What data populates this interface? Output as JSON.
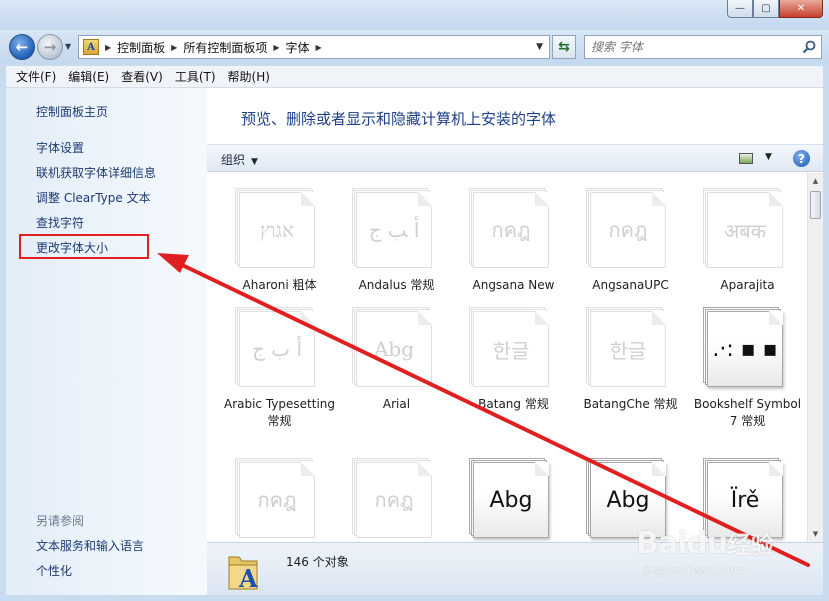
{
  "address": {
    "breadcrumbs": [
      "控制面板",
      "所有控制面板项",
      "字体"
    ]
  },
  "search": {
    "placeholder": "搜索 字体"
  },
  "menu": [
    "文件(F)",
    "编辑(E)",
    "查看(V)",
    "工具(T)",
    "帮助(H)"
  ],
  "sidebar": {
    "home": "控制面板主页",
    "items": [
      "字体设置",
      "联机获取字体详细信息",
      "调整 ClearType 文本",
      "查找字符",
      "更改字体大小"
    ],
    "see_also_title": "另请参阅",
    "see_also": [
      "文本服务和输入语言",
      "个性化"
    ]
  },
  "main": {
    "heading": "预览、删除或者显示和隐藏计算机上安装的字体",
    "organize": "组织"
  },
  "fonts": [
    {
      "sample": "אגוץ",
      "name": "Aharoni 粗体",
      "style": "faded"
    },
    {
      "sample": "ﺃ ﺐ ﺝ",
      "name": "Andalus 常规",
      "style": "faded"
    },
    {
      "sample": "กคฎ",
      "name": "Angsana New",
      "style": "faded"
    },
    {
      "sample": "กคฎ",
      "name": "AngsanaUPC",
      "style": "faded"
    },
    {
      "sample": "अबक",
      "name": "Aparajita",
      "style": "faded"
    },
    {
      "sample": "أ ب ج",
      "name": "Arabic Typesetting 常规",
      "style": "faded"
    },
    {
      "sample": "Abg",
      "name": "Arial",
      "style": "faded"
    },
    {
      "sample": "한글",
      "name": "Batang 常规",
      "style": "faded"
    },
    {
      "sample": "한글",
      "name": "BatangChe 常规",
      "style": "faded"
    },
    {
      "sample": ".·: ▪ ▪",
      "name": "Bookshelf Symbol 7 常规",
      "style": "dark"
    },
    {
      "sample": "กคฎ",
      "name": "",
      "style": "faded"
    },
    {
      "sample": "กคฎ",
      "name": "",
      "style": "faded"
    },
    {
      "sample": "Abg",
      "name": "",
      "style": "dark"
    },
    {
      "sample": "Abg",
      "name": "",
      "style": "dark"
    },
    {
      "sample": "Ïrě",
      "name": "",
      "style": "dark"
    }
  ],
  "status": {
    "count": "146 个对象"
  },
  "watermark": {
    "brand": "Baidu",
    "brand_cn": "经验",
    "url": "jingyan.baidu.com"
  },
  "colors": {
    "highlight": "#e02020",
    "arrow": "#e02020",
    "link": "#1d3a73",
    "heading": "#1e3f8a"
  }
}
